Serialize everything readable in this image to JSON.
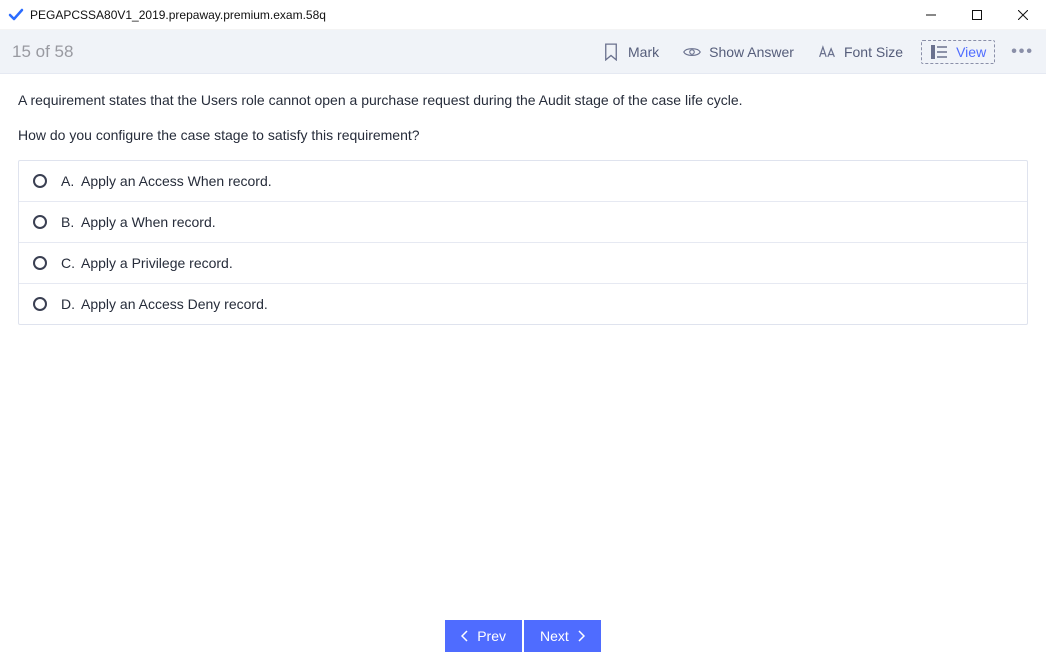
{
  "window": {
    "title": "PEGAPCSSA80V1_2019.prepaway.premium.exam.58q"
  },
  "toolbar": {
    "progress": "15 of 58",
    "mark": "Mark",
    "show_answer": "Show Answer",
    "font_size": "Font Size",
    "view": "View"
  },
  "question": {
    "line1": "A requirement states that the Users role cannot open a purchase request during the Audit stage of the case life cycle.",
    "line2": "How do you configure the case stage to satisfy this requirement?"
  },
  "answers": [
    {
      "letter": "A.",
      "text": "Apply an Access When record."
    },
    {
      "letter": "B.",
      "text": "Apply a When record."
    },
    {
      "letter": "C.",
      "text": "Apply a Privilege record."
    },
    {
      "letter": "D.",
      "text": "Apply an Access Deny record."
    }
  ],
  "nav": {
    "prev": "Prev",
    "next": "Next"
  }
}
